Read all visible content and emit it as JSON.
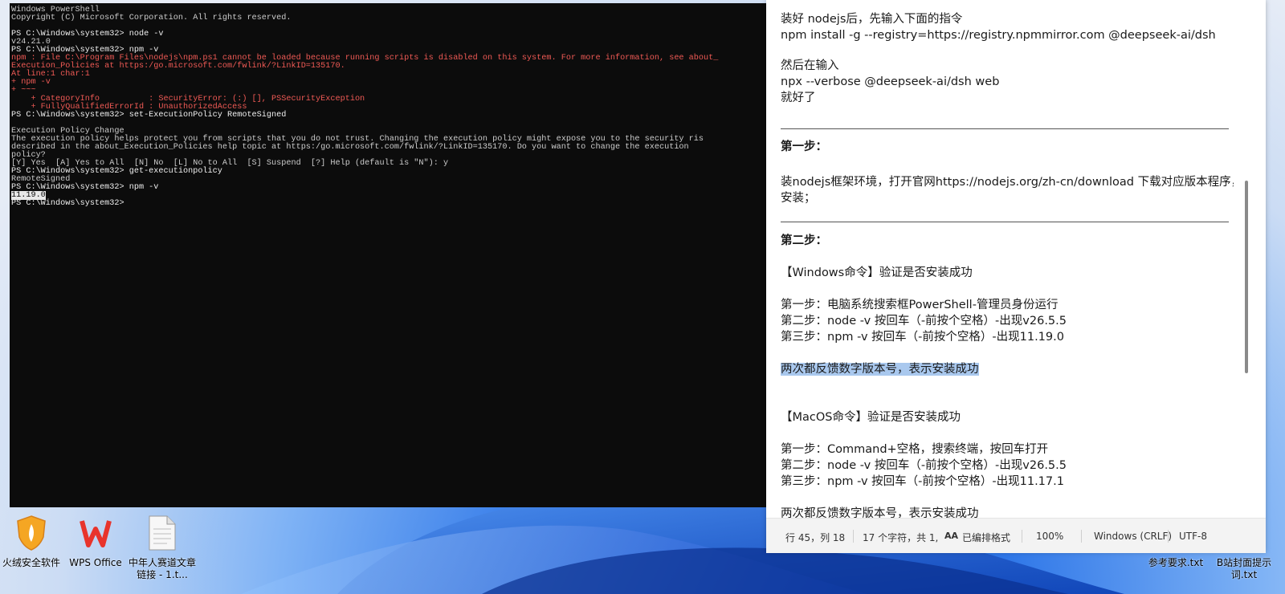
{
  "powershell": {
    "lines": [
      {
        "t": "Windows PowerShell",
        "c": "out"
      },
      {
        "t": "Copyright (C) Microsoft Corporation. All rights reserved.",
        "c": "out"
      },
      {
        "t": "",
        "c": "out"
      },
      {
        "t": "PS C:\\Windows\\system32> node -v",
        "c": "cmd"
      },
      {
        "t": "v24.21.0",
        "c": "out"
      },
      {
        "t": "PS C:\\Windows\\system32> npm -v",
        "c": "cmd"
      },
      {
        "t": "npm : File C:\\Program Files\\nodejs\\npm.ps1 cannot be loaded because running scripts is disabled on this system. For more information, see about_",
        "c": "err"
      },
      {
        "t": "Execution_Policies at https:/go.microsoft.com/fwlink/?LinkID=135170.",
        "c": "err"
      },
      {
        "t": "At line:1 char:1",
        "c": "err"
      },
      {
        "t": "+ npm -v",
        "c": "err"
      },
      {
        "t": "+ ~~~",
        "c": "err"
      },
      {
        "t": "    + CategoryInfo          : SecurityError: (:) [], PSSecurityException",
        "c": "err"
      },
      {
        "t": "    + FullyQualifiedErrorId : UnauthorizedAccess",
        "c": "err"
      },
      {
        "t": "PS C:\\Windows\\system32> set-ExecutionPolicy RemoteSigned",
        "c": "cmd"
      },
      {
        "t": "",
        "c": "out"
      },
      {
        "t": "Execution Policy Change",
        "c": "out"
      },
      {
        "t": "The execution policy helps protect you from scripts that you do not trust. Changing the execution policy might expose you to the security ris",
        "c": "out"
      },
      {
        "t": "described in the about_Execution_Policies help topic at https:/go.microsoft.com/fwlink/?LinkID=135170. Do you want to change the execution",
        "c": "out"
      },
      {
        "t": "policy?",
        "c": "out"
      },
      {
        "t": "[Y] Yes  [A] Yes to All  [N] No  [L] No to All  [S] Suspend  [?] Help (default is \"N\"): y",
        "c": "out"
      },
      {
        "t": "PS C:\\Windows\\system32> get-executionpolicy",
        "c": "cmd"
      },
      {
        "t": "RemoteSigned",
        "c": "out"
      },
      {
        "t": "PS C:\\Windows\\system32> npm -v",
        "c": "cmd"
      },
      {
        "t": "11.19.0",
        "c": "sel"
      },
      {
        "t": "PS C:\\Windows\\system32>",
        "c": "cmd"
      }
    ]
  },
  "notepad": {
    "lines": {
      "l1": "装好 nodejs后，先输入下面的指令",
      "l2": "npm install -g --registry=https://registry.npmmirror.com @deepseek-ai/dsh",
      "l3": "然后在输入",
      "l4": "npx --verbose @deepseek-ai/dsh web",
      "l5": "就好了",
      "step1_title": "第一步：",
      "step1_body": "装nodejs框架环境，打开官网https://nodejs.org/zh-cn/download   下载对应版本程序，安装；",
      "step2_title": "第二步：",
      "win_title": "【Windows命令】验证是否安装成功",
      "win_s1": "第一步：电脑系统搜索框PowerShell-管理员身份运行",
      "win_s2": "第二步：node -v 按回车（-前按个空格）-出现v26.5.5",
      "win_s3": "第三步：npm -v 按回车（-前按个空格）-出现11.19.0",
      "win_ok": "两次都反馈数字版本号，表示安装成功",
      "mac_title": "【MacOS命令】验证是否安装成功",
      "mac_s1": "第一步：Command+空格，搜索终端，按回车打开",
      "mac_s2": "第二步：node -v 按回车（-前按个空格）-出现v26.5.5",
      "mac_s3": "第三步：npm -v 按回车（-前按个空格）-出现11.17.1",
      "mac_ok": "两次都反馈数字版本号，表示安装成功"
    },
    "status": {
      "position": "行 45，列 18",
      "selection": "17 个字符，共 1,",
      "format": "已编排格式",
      "zoom": "100%",
      "line_ending": "Windows (CRLF)",
      "encoding": "UTF-8"
    }
  },
  "desktop": {
    "icons": [
      {
        "label": "火绒安全软件"
      },
      {
        "label": "WPS Office"
      },
      {
        "label": "中年人赛道文章链接 - 1.t..."
      },
      {
        "label": "参考要求.txt"
      },
      {
        "label": "B站封面提示词.txt"
      }
    ]
  },
  "colors": {
    "terminal_bg": "#0c0c0c",
    "terminal_error": "#f05a55",
    "selection_highlight": "#a9c8ee"
  }
}
